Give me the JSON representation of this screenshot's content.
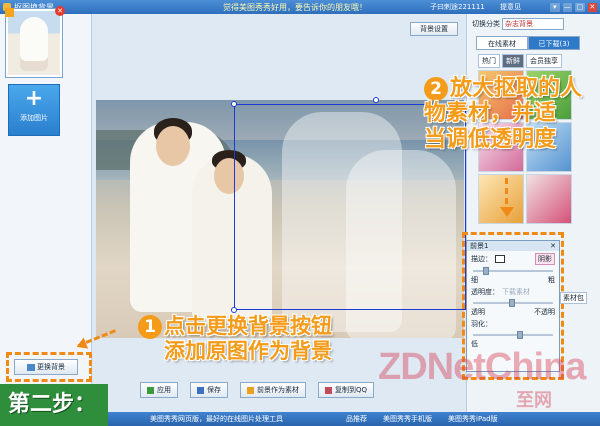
{
  "titlebar": {
    "app_title": "抠图换背景",
    "notice": "觉得美图秀秀好用，要告诉你的朋友哦！",
    "user": "子曰刺途221111",
    "feedback": "提意见",
    "controls": [
      "▾",
      "—",
      "□",
      "✕"
    ]
  },
  "left_panel": {
    "add_image_label": "添加图片",
    "add_image_icon": "plus-icon",
    "replace_bg_label": "更换背景"
  },
  "toolbar": {
    "bg_settings": "背景设置",
    "category_label": "切换分类",
    "category_value": "杂志背景"
  },
  "material_panel": {
    "tabs": [
      "在线素材",
      "已下载(3)"
    ],
    "active_tab": 1,
    "subtabs": [
      "热门",
      "新鲜",
      "会员独享"
    ],
    "active_subtab": 1
  },
  "properties": {
    "header": "前景1",
    "close": "✕",
    "stroke_label": "描边：",
    "shadow_label": "阴影",
    "thin_label": "细",
    "thick_label": "粗",
    "opacity_label": "透明度：",
    "remove_label": "下载素材",
    "transparent_label": "透明",
    "opaque_label": "不透明",
    "feather_label": "羽化：",
    "low_label": "低",
    "fringe_label": "素材包",
    "stroke_value": 0.12,
    "opacity_value": 0.45,
    "feather_value": 0.55
  },
  "bottom_actions": {
    "apply": "应用",
    "save": "保存",
    "fg_to_material": "前景作为素材",
    "copy_to_qq": "复制到QQ"
  },
  "statusbar": {
    "left": "美图秀秀网页版，最好的在线图片处理工具",
    "mid": "品推荐",
    "mobile": "美图秀秀手机版",
    "ipad": "美图秀秀iPad版"
  },
  "annotations": {
    "step_number_1": "1",
    "step_line_1a": "点击更换背景按钮",
    "step_line_1b": "添加原图作为背景",
    "step_number_2": "2",
    "step_line_2a": "放大抠取的人",
    "step_line_2b": "物素材，并适",
    "step_line_2c": "当调低透明度",
    "step_badge": "第二步：",
    "watermark": "ZDNetChina",
    "watermark_sub": "至网"
  }
}
